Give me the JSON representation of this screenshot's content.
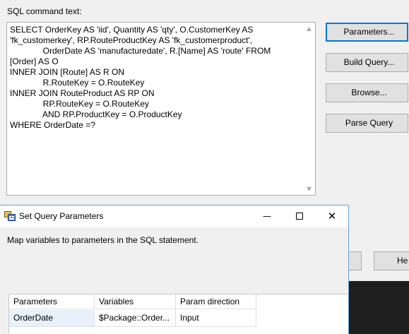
{
  "editor": {
    "sql_label": "SQL command text:",
    "sql_lines": [
      "SELECT OrderKey AS 'iid', Quantity AS 'qty', O.CustomerKey AS",
      "'fk_customerkey', RP.RouteProductKey AS 'fk_customerproduct',",
      "              OrderDate AS 'manufacturedate', R.[Name] AS 'route' FROM",
      "[Order] AS O",
      "INNER JOIN [Route] AS R ON",
      "              R.RouteKey = O.RouteKey",
      "INNER JOIN RouteProduct AS RP ON",
      "              RP.RouteKey = O.RouteKey",
      "              AND RP.ProductKey = O.ProductKey",
      "WHERE OrderDate =?"
    ],
    "buttons": {
      "parameters": "Parameters...",
      "build_query": "Build Query...",
      "browse": "Browse...",
      "parse_query": "Parse Query"
    },
    "help_button_partial": "He"
  },
  "dialog": {
    "title": "Set Query Parameters",
    "instruction": "Map variables to parameters in the SQL statement.",
    "columns": [
      "Parameters",
      "Variables",
      "Param direction"
    ],
    "rows": [
      {
        "parameter": "OrderDate",
        "variable": "$Package::Order...",
        "direction": "Input"
      }
    ],
    "caption_icons": {
      "minimize": "minimize-icon",
      "maximize": "maximize-icon",
      "close": "close-icon"
    }
  }
}
